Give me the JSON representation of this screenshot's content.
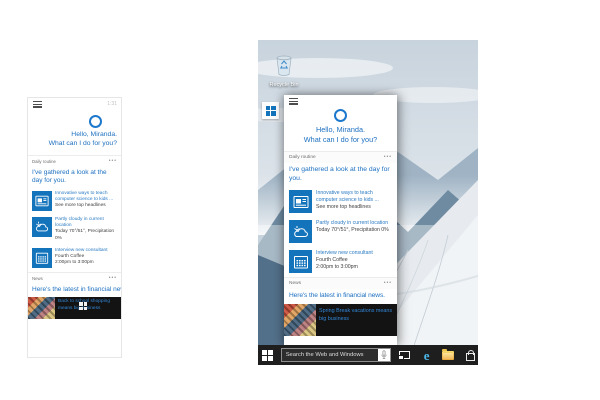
{
  "cortana": {
    "greeting_line1": "Hello, Miranda.",
    "greeting_line2": "What can I do for you?",
    "daily_section_label": "Daily routine",
    "more_glyph": "•••",
    "daily_intro": "I've gathered a look at the day for you.",
    "cards": [
      {
        "icon": "news",
        "title": "Innovative ways to teach computer science to kids ...",
        "lines": [
          "See more top headlines"
        ]
      },
      {
        "icon": "weather",
        "title": "Partly cloudy in current location",
        "lines": [
          "Today 70°/51°, Precipitation 0%"
        ]
      },
      {
        "icon": "calendar",
        "title": "Interview new consultant",
        "lines": [
          "Fourth Coffee",
          "2:00pm to 3:00pm"
        ]
      }
    ],
    "news_section_label": "News",
    "news_intro": "Here's the latest in financial news."
  },
  "phone": {
    "time": "1:31",
    "news_headline": "Back to school shopping means big business"
  },
  "desktop": {
    "recycle_bin_label": "Recycle Bin",
    "news_headline": "Spring Break vacations means big business",
    "taskbar": {
      "search_placeholder": "Search the Web and Windows"
    }
  },
  "colors": {
    "cortana_text_blue": "#1d70c0",
    "tile_blue": "#1374bc",
    "ring_blue": "#1b78cd",
    "taskbar_dark": "#1e1e1e"
  }
}
